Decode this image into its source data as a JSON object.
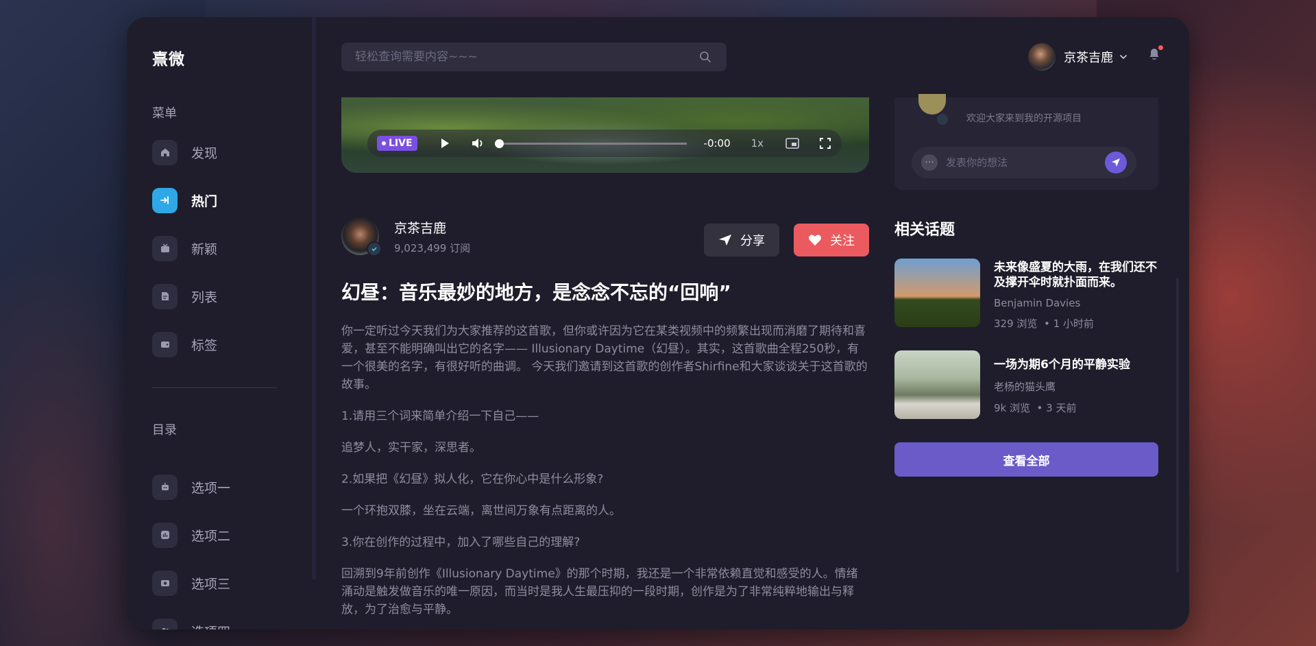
{
  "brand": "熹微",
  "menu": {
    "title": "菜单",
    "items": [
      {
        "label": "发现",
        "icon": "home-icon"
      },
      {
        "label": "热门",
        "icon": "login-arrow-icon",
        "active": true
      },
      {
        "label": "新颖",
        "icon": "tv-icon"
      },
      {
        "label": "列表",
        "icon": "document-icon"
      },
      {
        "label": "标签",
        "icon": "wallet-icon"
      }
    ]
  },
  "catalog": {
    "title": "目录",
    "items": [
      {
        "label": "选项一",
        "icon": "robot-icon"
      },
      {
        "label": "选项二",
        "icon": "chart-icon"
      },
      {
        "label": "选项三",
        "icon": "camera-icon"
      },
      {
        "label": "选项四",
        "icon": "users-icon"
      }
    ]
  },
  "search": {
    "placeholder": "轻松查询需要内容~~~"
  },
  "user": {
    "name": "京茶吉鹿"
  },
  "player": {
    "live": "LIVE",
    "time": "-0:00",
    "rate": "1x",
    "progress": 0
  },
  "author": {
    "name": "京茶吉鹿",
    "subs": "9,023,499 订阅"
  },
  "actions": {
    "share": "分享",
    "follow": "关注"
  },
  "article": {
    "title": "幻昼：音乐最妙的地方，是念念不忘的“回响”",
    "paragraphs": [
      "你一定听过今天我们为大家推荐的这首歌，但你或许因为它在某类视频中的频繁出现而消磨了期待和喜爱，甚至不能明确叫出它的名字—— Illusionary Daytime（幻昼）。其实，这首歌曲全程250秒，有一个很美的名字，有很好听的曲调。 今天我们邀请到这首歌的创作者Shirfine和大家谈谈关于这首歌的故事。",
      "1.请用三个词来简单介绍一下自己——",
      "追梦人，实干家，深思者。",
      "2.如果把《幻昼》拟人化，它在你心中是什么形象?",
      "一个环抱双膝，坐在云端，离世间万象有点距离的人。",
      "3.你在创作的过程中，加入了哪些自己的理解?",
      "回溯到9年前创作《Illusionary Daytime》的那个时期，我还是一个非常依赖直觉和感受的人。情绪涌动是触发做音乐的唯一原因，而当时是我人生最压抑的一段时期，创作是为了非常纯粹地输出与释放，为了治愈与平静。"
    ]
  },
  "comment": {
    "preview": "欢迎大家来到我的开源项目",
    "placeholder": "发表你的想法"
  },
  "related": {
    "title": "相关话题",
    "items": [
      {
        "title": "未来像盛夏的大雨，在我们还不及撑开伞时就扑面而来。",
        "author": "Benjamin Davies",
        "views": "329 浏览",
        "time": "1 小时前"
      },
      {
        "title": "一场为期6个月的平静实验",
        "author": "老杨的猫头鹰",
        "views": "9k 浏览",
        "time": "3 天前"
      }
    ],
    "view_all": "查看全部"
  }
}
